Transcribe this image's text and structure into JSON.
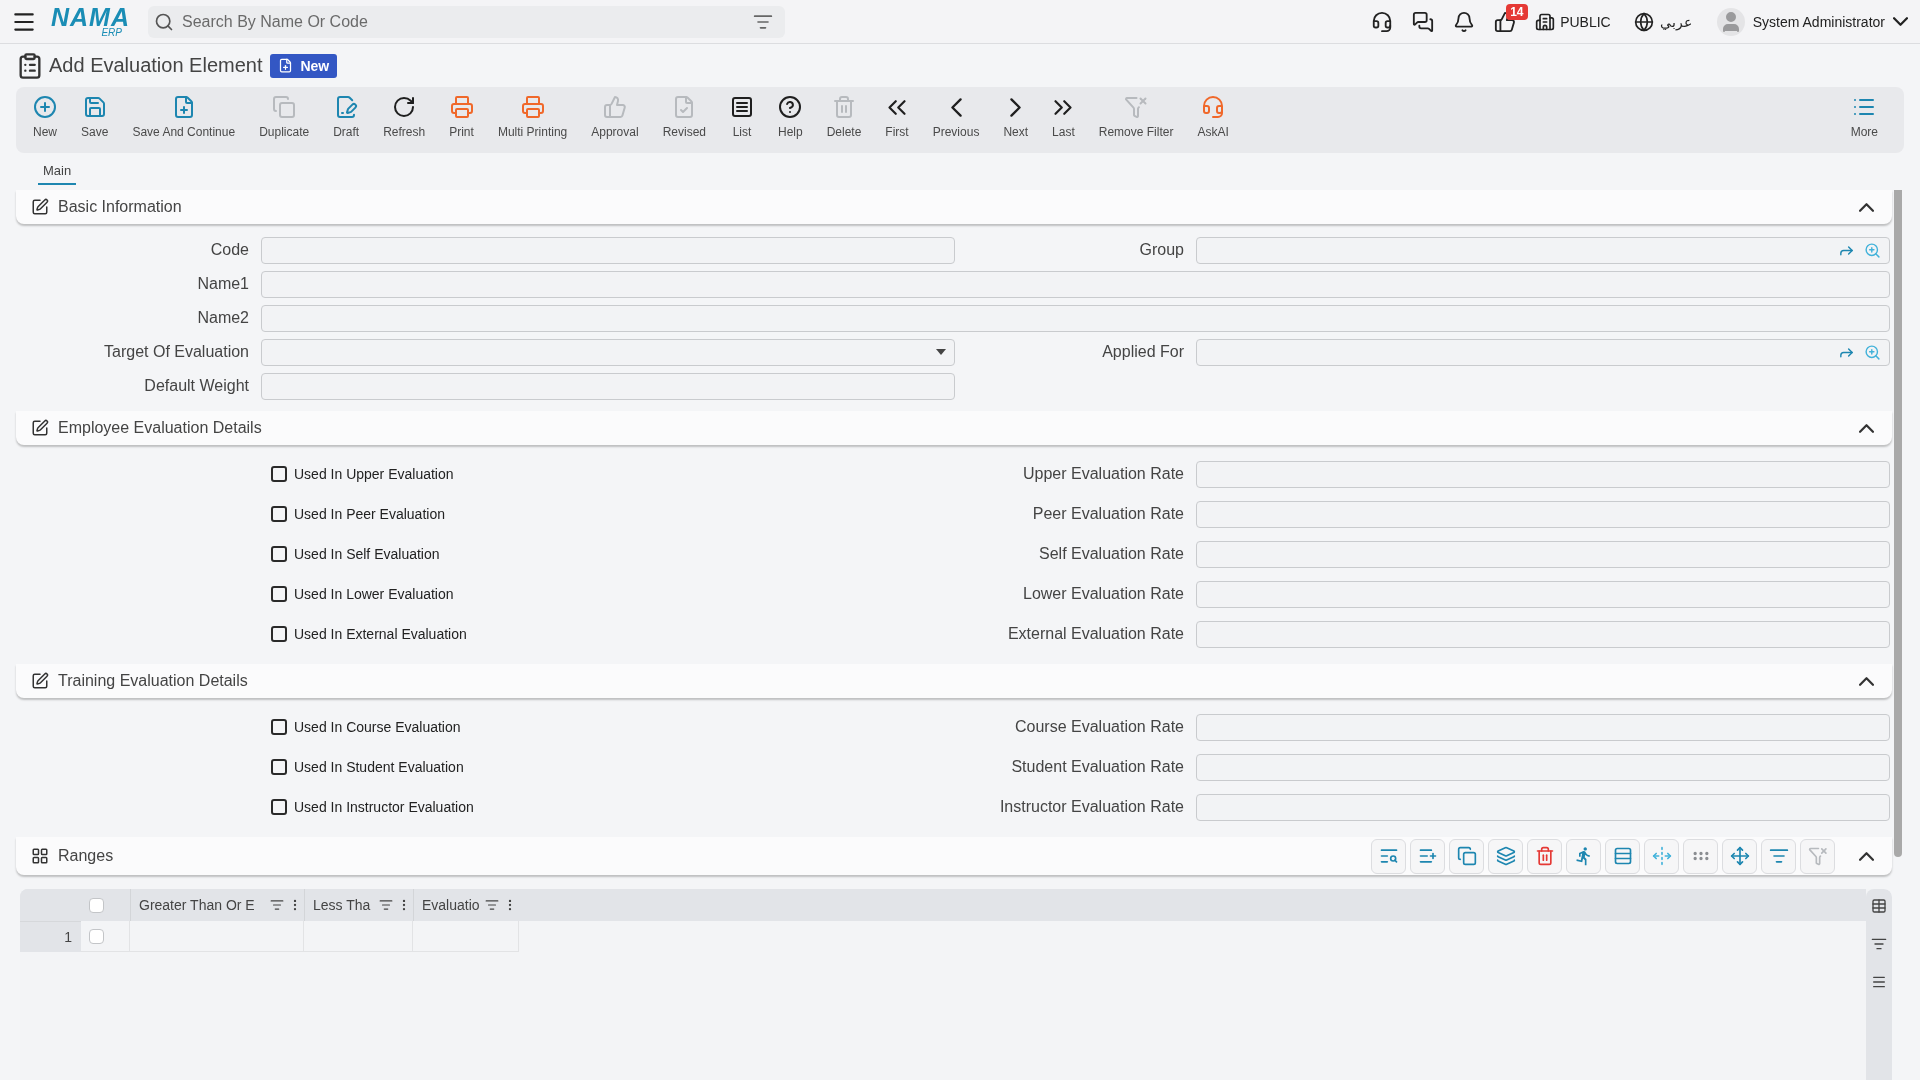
{
  "header": {
    "logo": {
      "name": "NAMA",
      "suffix": "ERP"
    },
    "search": {
      "placeholder": "Search By Name Or Code"
    },
    "notification_count": "14",
    "company": "PUBLIC",
    "language": "عربي",
    "user": "System Administrator"
  },
  "page": {
    "title": "Add Evaluation Element",
    "status": "New"
  },
  "toolbar": [
    {
      "kind": "new",
      "label": "New",
      "disabled": false
    },
    {
      "kind": "save",
      "label": "Save",
      "disabled": false
    },
    {
      "kind": "continue",
      "label": "Save And Continue",
      "disabled": false
    },
    {
      "kind": "duplicate",
      "label": "Duplicate",
      "disabled": true
    },
    {
      "kind": "draft",
      "label": "Draft",
      "disabled": false
    },
    {
      "kind": "refresh",
      "label": "Refresh",
      "disabled": false
    },
    {
      "kind": "print",
      "label": "Print",
      "disabled": false
    },
    {
      "kind": "multiprint",
      "label": "Multi Printing",
      "disabled": false
    },
    {
      "kind": "approval",
      "label": "Approval",
      "disabled": true
    },
    {
      "kind": "revised",
      "label": "Revised",
      "disabled": true
    },
    {
      "kind": "list",
      "label": "List",
      "disabled": false
    },
    {
      "kind": "help",
      "label": "Help",
      "disabled": false
    },
    {
      "kind": "delete",
      "label": "Delete",
      "disabled": true
    },
    {
      "kind": "first",
      "label": "First",
      "disabled": false
    },
    {
      "kind": "previous",
      "label": "Previous",
      "disabled": false
    },
    {
      "kind": "next",
      "label": "Next",
      "disabled": false
    },
    {
      "kind": "last",
      "label": "Last",
      "disabled": false
    },
    {
      "kind": "unfilter",
      "label": "Remove Filter",
      "disabled": true
    },
    {
      "kind": "askai",
      "label": "AskAI",
      "disabled": false
    },
    {
      "kind": "more",
      "label": "More",
      "disabled": false
    }
  ],
  "tabs": [
    {
      "label": "Main",
      "selected": true
    }
  ],
  "sections": [
    {
      "kind": "form",
      "title": "Basic Information",
      "expanded": true,
      "rows": [
        [
          {
            "kind": "text",
            "label": "Code"
          },
          {
            "kind": "lookup",
            "label": "Group"
          }
        ],
        [
          {
            "kind": "text",
            "label": "Name1",
            "wide": true
          }
        ],
        [
          {
            "kind": "text",
            "label": "Name2",
            "wide": true
          }
        ],
        [
          {
            "kind": "select",
            "label": "Target Of Evaluation"
          },
          {
            "kind": "lookup",
            "label": "Applied For"
          }
        ],
        [
          {
            "kind": "text",
            "label": "Default Weight"
          }
        ]
      ]
    },
    {
      "kind": "form",
      "title": "Employee Evaluation Details",
      "expanded": true,
      "rows": [
        [
          {
            "kind": "checkbox",
            "label": "Used In Upper Evaluation",
            "checked": false
          },
          {
            "kind": "text",
            "label": "Upper Evaluation Rate"
          }
        ],
        [
          {
            "kind": "checkbox",
            "label": "Used In Peer Evaluation",
            "checked": false
          },
          {
            "kind": "text",
            "label": "Peer Evaluation Rate"
          }
        ],
        [
          {
            "kind": "checkbox",
            "label": "Used In Self Evaluation",
            "checked": false
          },
          {
            "kind": "text",
            "label": "Self Evaluation Rate"
          }
        ],
        [
          {
            "kind": "checkbox",
            "label": "Used In Lower Evaluation",
            "checked": false
          },
          {
            "kind": "text",
            "label": "Lower Evaluation Rate"
          }
        ],
        [
          {
            "kind": "checkbox",
            "label": "Used In External Evaluation",
            "checked": false
          },
          {
            "kind": "text",
            "label": "External Evaluation Rate"
          }
        ]
      ]
    },
    {
      "kind": "form",
      "title": "Training Evaluation Details",
      "expanded": true,
      "rows": [
        [
          {
            "kind": "checkbox",
            "label": "Used In Course Evaluation",
            "checked": false
          },
          {
            "kind": "text",
            "label": "Course Evaluation Rate"
          }
        ],
        [
          {
            "kind": "checkbox",
            "label": "Used In Student Evaluation",
            "checked": false
          },
          {
            "kind": "text",
            "label": "Student Evaluation Rate"
          }
        ],
        [
          {
            "kind": "checkbox",
            "label": "Used In Instructor Evaluation",
            "checked": false
          },
          {
            "kind": "text",
            "label": "Instructor Evaluation Rate"
          }
        ]
      ]
    },
    {
      "kind": "grid",
      "title": "Ranges",
      "expanded": true,
      "tools": [
        {
          "kind": "find",
          "disabled": false
        },
        {
          "kind": "addrow",
          "disabled": false
        },
        {
          "kind": "copy",
          "disabled": false
        },
        {
          "kind": "layers",
          "disabled": false
        },
        {
          "kind": "delete",
          "disabled": false
        },
        {
          "kind": "run",
          "disabled": false
        },
        {
          "kind": "rows",
          "disabled": false
        },
        {
          "kind": "resize",
          "disabled": false
        },
        {
          "kind": "dots",
          "disabled": false
        },
        {
          "kind": "move",
          "disabled": false
        },
        {
          "kind": "filter",
          "disabled": false
        },
        {
          "kind": "unfilter",
          "disabled": true
        }
      ],
      "table": {
        "columns": [
          "Greater Than Or E",
          "Less Tha",
          "Evaluatio"
        ],
        "select_all": false,
        "rows": [
          {
            "number": "1",
            "selected": false
          }
        ]
      }
    }
  ]
}
